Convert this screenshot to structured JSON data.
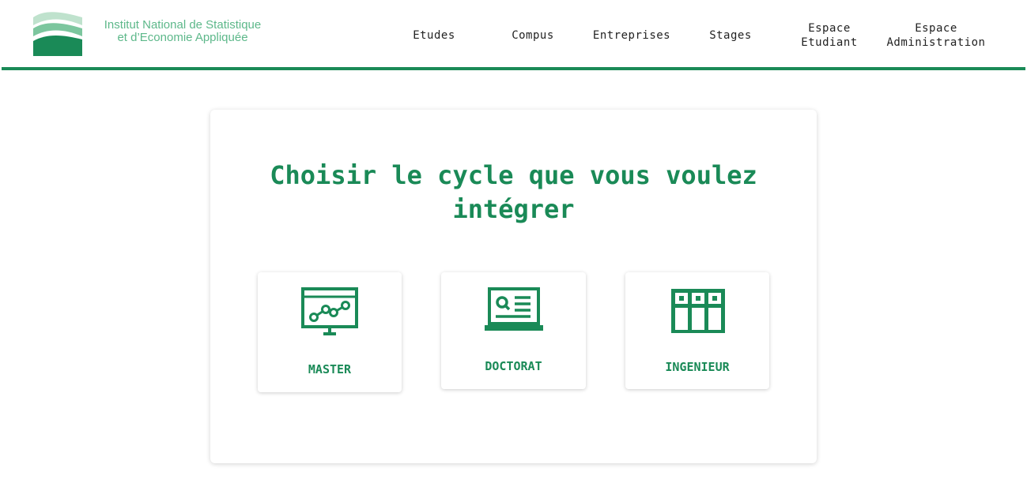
{
  "header": {
    "logo": {
      "line1": "Institut National de Statistique",
      "line2": "et d’Economie Appliquée"
    },
    "nav": [
      {
        "label": "Etudes"
      },
      {
        "label": "Compus"
      },
      {
        "label": "Entreprises"
      },
      {
        "label": "Stages"
      },
      {
        "label_line1": "Espace",
        "label_line2": "Etudiant"
      },
      {
        "label_line1": "Espace",
        "label_line2": "Administration"
      }
    ]
  },
  "main": {
    "title": "Choisir le cycle que vous voulez intégrer",
    "options": [
      {
        "label": "MASTER",
        "icon": "presentation-chart-icon"
      },
      {
        "label": "DOCTORAT",
        "icon": "research-laptop-icon"
      },
      {
        "label": "INGENIEUR",
        "icon": "building-grid-icon"
      }
    ]
  },
  "colors": {
    "accent": "#1a8a57",
    "logo_light": "#a9d7bd",
    "logo_mid": "#5db88a"
  }
}
